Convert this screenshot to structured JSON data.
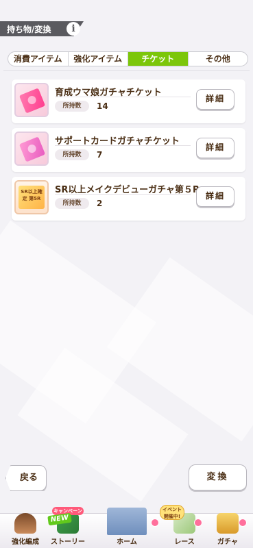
{
  "header": {
    "title": "持ち物/変換",
    "info_icon": "info-icon"
  },
  "tabs": [
    {
      "label": "消費アイテム",
      "active": false
    },
    {
      "label": "強化アイテム",
      "active": false
    },
    {
      "label": "チケット",
      "active": true
    },
    {
      "label": "その他",
      "active": false
    }
  ],
  "items": [
    {
      "name": "育成ウマ娘ガチャチケット",
      "owned_label": "所持数",
      "owned_count": "14",
      "detail_label": "詳細",
      "icon": "pink-ticket-icon"
    },
    {
      "name": "サポートカードガチャチケット",
      "owned_label": "所持数",
      "owned_count": "7",
      "detail_label": "詳細",
      "icon": "support-ticket-icon"
    },
    {
      "name": "SR以上メイクデビューガチャ第５R",
      "owned_label": "所持数",
      "owned_count": "2",
      "detail_label": "詳細",
      "icon": "sr-card-icon",
      "icon_text": "SR以上確定 第5R"
    }
  ],
  "footer": {
    "back_label": "戻る",
    "exchange_label": "変換"
  },
  "nav": {
    "items": [
      {
        "label": "強化編成",
        "icon": "horse-girl-avatar-icon"
      },
      {
        "label": "ストーリー",
        "icon": "story-book-icon",
        "badge_campaign": "キャンペーン中",
        "badge_new": "NEW"
      },
      {
        "label": "ホーム",
        "icon": "home-building-icon"
      },
      {
        "label": "レース",
        "icon": "race-map-icon",
        "badge_event": "イベント開催中!"
      },
      {
        "label": "ガチャ",
        "icon": "gacha-icon"
      }
    ]
  },
  "colors": {
    "accent_tab": "#7cc60a",
    "text_brown": "#4a2e14",
    "header_dark": "#5a5a5f"
  }
}
